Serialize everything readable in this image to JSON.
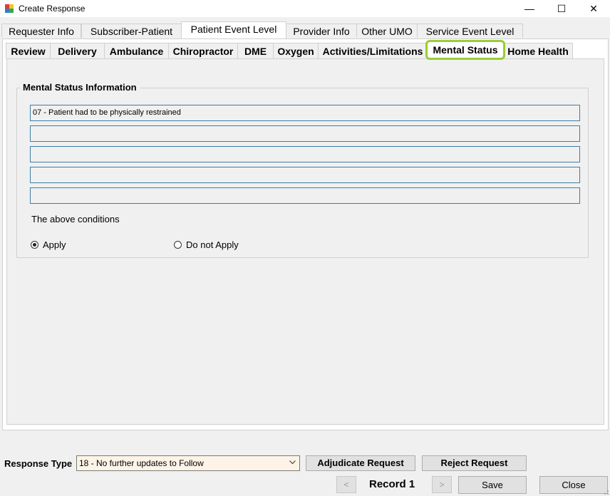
{
  "window": {
    "title": "Create Response",
    "controls": {
      "minimize": "—",
      "maximize": "☐",
      "close": "✕"
    }
  },
  "tabs_primary": [
    {
      "label": "Requester Info",
      "active": false
    },
    {
      "label": "Subscriber-Patient",
      "active": false
    },
    {
      "label": "Patient Event Level",
      "active": true
    },
    {
      "label": "Provider Info",
      "active": false
    },
    {
      "label": "Other UMO",
      "active": false
    },
    {
      "label": "Service Event Level",
      "active": false
    }
  ],
  "tabs_secondary": [
    {
      "label": "Review",
      "active": false
    },
    {
      "label": "Delivery",
      "active": false
    },
    {
      "label": "Ambulance",
      "active": false
    },
    {
      "label": "Chiropractor",
      "active": false
    },
    {
      "label": "DME",
      "active": false
    },
    {
      "label": "Oxygen",
      "active": false
    },
    {
      "label": "Activities/Limitations",
      "active": false
    },
    {
      "label": "Mental Status",
      "active": true
    },
    {
      "label": "Home Health",
      "active": false
    }
  ],
  "mental_status": {
    "group_title": "Mental Status Information",
    "fields": [
      "07 - Patient had to be physically restrained",
      "",
      "",
      "",
      ""
    ],
    "conditions_label": "The above conditions",
    "options": [
      {
        "label": "Apply",
        "checked": true
      },
      {
        "label": "Do not Apply",
        "checked": false
      }
    ]
  },
  "footer": {
    "response_type_label": "Response Type",
    "response_type_value": "18 - No further updates to Follow",
    "adjudicate_label": "Adjudicate Request",
    "reject_label": "Reject Request",
    "prev_label": "<",
    "record_label": "Record 1",
    "next_label": ">",
    "save_label": "Save",
    "close_label": "Close"
  },
  "colors": {
    "highlight": "#9acd32",
    "field_border": "#3d7fa5",
    "combo_bg": "#fdf3e7"
  }
}
